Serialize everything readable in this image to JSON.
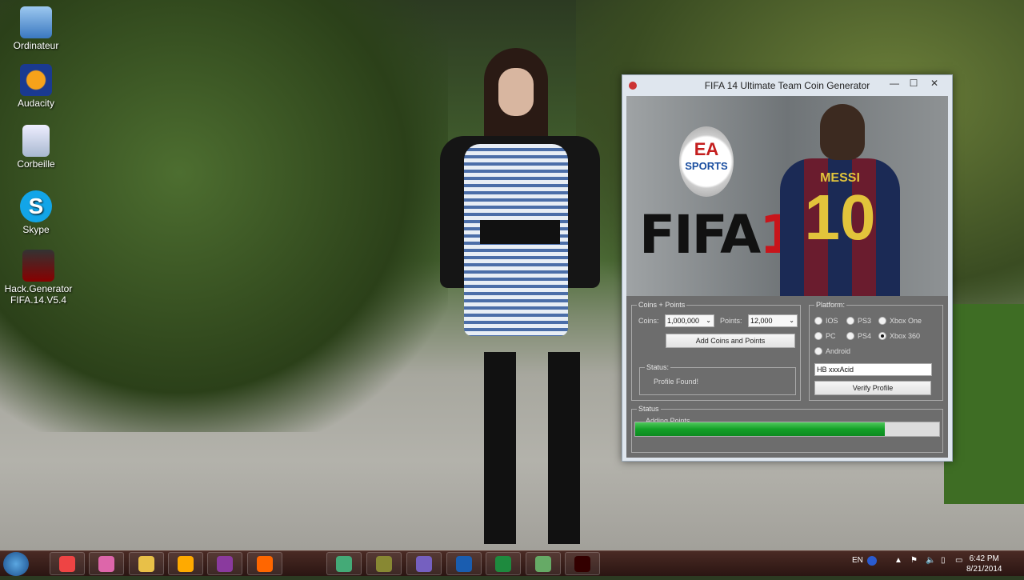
{
  "desktop": {
    "icons": [
      {
        "label": "Ordinateur",
        "icon": "computer-icon"
      },
      {
        "label": "Audacity",
        "icon": "audacity-icon"
      },
      {
        "label": "Corbeille",
        "icon": "recycle-bin-icon"
      },
      {
        "label": "Skype",
        "icon": "skype-icon"
      },
      {
        "label": "Hack.Generator FIFA.14.V5.4",
        "icon": "fifa14-icon"
      }
    ]
  },
  "window": {
    "title": "FIFA 14 Ultimate Team Coin Generator",
    "banner": {
      "ea": "EA",
      "sports": "SPORTS",
      "fifa": "FIFA",
      "num14": "14",
      "player_name": "MESSI",
      "player_number": "10"
    },
    "coins_group": {
      "label": "Coins + Points",
      "coins_label": "Coins:",
      "coins_value": "1,000,000",
      "points_label": "Points:",
      "points_value": "12,000",
      "add_button": "Add Coins and Points"
    },
    "status_group": {
      "label": "Status:",
      "text": "Profile Found!"
    },
    "platform_group": {
      "label": "Platform:",
      "options": [
        "IOS",
        "PS3",
        "Xbox One",
        "PC",
        "PS4",
        "Xbox 360",
        "Android"
      ],
      "selected": "Xbox 360",
      "username": "HB xxxAcid",
      "verify_button": "Verify Profile"
    },
    "progress_group": {
      "label": "Status",
      "text": "Adding Points...",
      "progress_percent": 82
    }
  },
  "taskbar": {
    "tray": {
      "language": "EN",
      "time": "6:42 PM",
      "date": "8/21/2014"
    },
    "apps": [
      "chrome",
      "messenger",
      "file-explorer",
      "winamp",
      "onenote",
      "firefox",
      "firefox-active",
      "app",
      "app2",
      "uplay",
      "vb",
      "excel",
      "app3",
      "fifa14"
    ]
  },
  "colors": {
    "progress": "#13a027",
    "client": "#6d6d6d"
  }
}
